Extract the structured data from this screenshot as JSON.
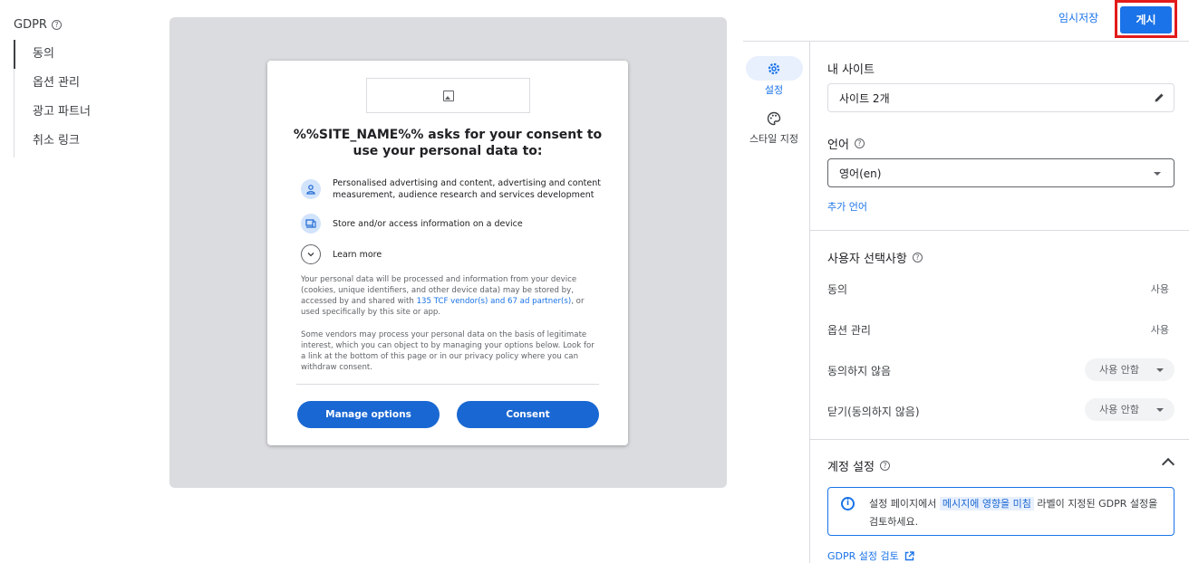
{
  "nav": {
    "title": "GDPR",
    "items": [
      {
        "label": "동의"
      },
      {
        "label": "옵션 관리"
      },
      {
        "label": "광고 파트너"
      },
      {
        "label": "취소 링크"
      }
    ]
  },
  "header": {
    "draft_label": "임시저장",
    "publish_label": "게시"
  },
  "preview": {
    "title": "%%SITE_NAME%% asks for your consent to use your personal data to:",
    "purposes": [
      {
        "icon": "person-icon",
        "text": "Personalised advertising and content, advertising and content measurement, audience research and services development"
      },
      {
        "icon": "device-icon",
        "text": "Store and/or access information on a device"
      }
    ],
    "learn_more": "Learn more",
    "para1_before": "Your personal data will be processed and information from your device (cookies, unique identifiers, and other device data) may be stored by, accessed by and shared with ",
    "para1_link": "135 TCF vendor(s) and 67 ad partner(s)",
    "para1_after": ", or used specifically by this site or app.",
    "para2": "Some vendors may process your personal data on the basis of legitimate interest, which you can object to by managing your options below. Look for a link at the bottom of this page or in our privacy policy where you can withdraw consent.",
    "manage_btn": "Manage options",
    "consent_btn": "Consent"
  },
  "rail": {
    "settings_label": "설정",
    "style_label": "스타일 지정"
  },
  "panel": {
    "site_label": "내 사이트",
    "site_value": "사이트 2개",
    "lang_label": "언어",
    "lang_value": "영어(en)",
    "add_lang": "추가 언어",
    "choices_label": "사용자 선택사항",
    "choices": [
      {
        "label": "동의",
        "value": "사용"
      },
      {
        "label": "옵션 관리",
        "value": "사용"
      },
      {
        "label": "동의하지 않음",
        "value": "사용 안함"
      },
      {
        "label": "닫기(동의하지 않음)",
        "value": "사용 안함"
      }
    ],
    "account_label": "계정 설정",
    "info_before": "설정 페이지에서 ",
    "info_chip": "메시지에 영향을 미침",
    "info_after": " 라벨이 지정된 GDPR 설정을 검토하세요.",
    "review_link": "GDPR 설정 검토"
  },
  "colors": {
    "accent": "#1a73e8",
    "button": "#1967d2",
    "highlight_border": "#e21b1b",
    "preview_bg": "#dadce0"
  }
}
